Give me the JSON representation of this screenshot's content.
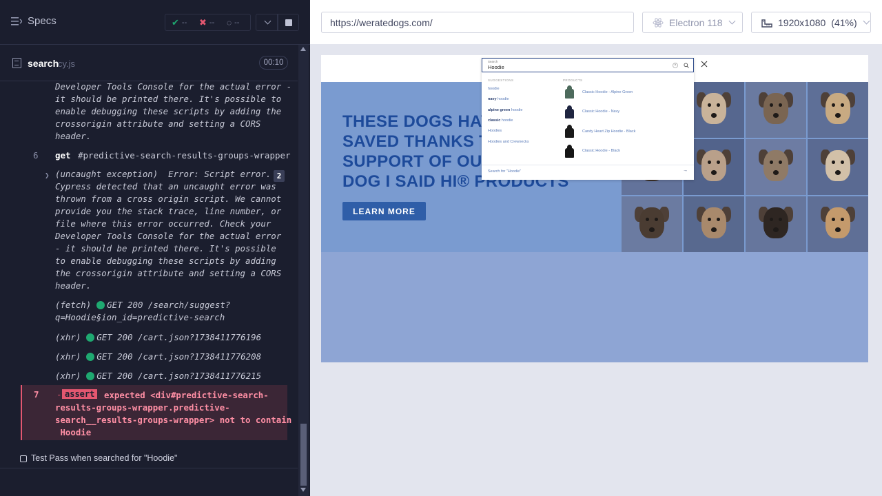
{
  "reporter": {
    "specs_label": "Specs",
    "stats": {
      "passed": "--",
      "failed": "--",
      "pending": "--"
    },
    "spec": {
      "name": "search",
      "ext": "cy.js",
      "time": "00:10"
    },
    "log": {
      "prev_error_tail": "Developer Tools Console for the actual error -\nit should be printed there. It's possible to\nenable debugging these scripts by adding the\ncrossorigin attribute and setting a CORS\nheader.",
      "cmd6": {
        "num": "6",
        "name": "get",
        "msg": "#predictive-search-results-groups-wrapper"
      },
      "uncaught_error": "(uncaught exception)  Error: Script error.\nCypress detected that an uncaught error was\nthrown from a cross origin script. We cannot\nprovide you the stack trace, line number, or\nfile where this error occurred. Check your\nDeveloper Tools Console for the actual error\n- it should be printed there. It's possible\nto enable debugging these scripts by adding\nthe crossorigin attribute and setting a CORS\nheader.",
      "uncaught_count": "2",
      "requests": [
        {
          "type": "(fetch)",
          "text": "GET 200 /search/suggest?",
          "text2": "q=Hoodie§ion_id=predictive-search"
        },
        {
          "type": "(xhr)",
          "text": "GET 200 /cart.json?1738411776196"
        },
        {
          "type": "(xhr)",
          "text": "GET 200 /cart.json?1738411776208"
        },
        {
          "type": "(xhr)",
          "text": "GET 200 /cart.json?1738411776215"
        }
      ],
      "assert": {
        "num": "7",
        "label": "assert",
        "text": "expected <div#predictive-search-\nresults-groups-wrapper.predictive-\nsearch__results-groups-wrapper> not to contain\n Hoodie"
      }
    },
    "test_title": "Test Pass when searched for \"Hoodie\""
  },
  "aut": {
    "url": "https://weratedogs.com/",
    "browser": "Electron 118",
    "viewport": "1920x1080",
    "zoom": "(41%)"
  },
  "site": {
    "hero_title": "THESE DOGS HAVE BEEN SAVED THANKS TO THE SUPPORT OF OUR DOG I SAID HI® PRODUCTS",
    "hero_visible_lines": [
      "THESE DOGS HAV",
      "SAVED THANKS T",
      "SUPPORT OF OUR",
      "DOG I SAID HI® PRODUCTS"
    ],
    "learn_more": "LEARN MORE",
    "search": {
      "floating_label": "Search",
      "value": "Hoodie",
      "suggestions_head": "SUGGESTIONS",
      "products_head": "PRODUCTS",
      "suggestions": [
        {
          "bold": "",
          "rest": "hoodie"
        },
        {
          "bold": "navy",
          "rest": " hoodie"
        },
        {
          "bold": "alpine green",
          "rest": " hoodie"
        },
        {
          "bold": "classic",
          "rest": " hoodie"
        },
        {
          "bold": "",
          "rest": "Hoodies"
        },
        {
          "bold": "",
          "rest": "Hoodies and Crewnecks"
        }
      ],
      "products": [
        {
          "name": "Classic Hoodie - Alpine Green",
          "color": "#4d6a5c"
        },
        {
          "name": "Classic Hoodie - Navy",
          "color": "#1f2540"
        },
        {
          "name": "Candy Heart Zip Hoodie - Black",
          "color": "#1a1a1a"
        },
        {
          "name": "Classic Hoodie - Black",
          "color": "#151515"
        }
      ],
      "search_for": "Search for \"Hoodie\""
    }
  }
}
